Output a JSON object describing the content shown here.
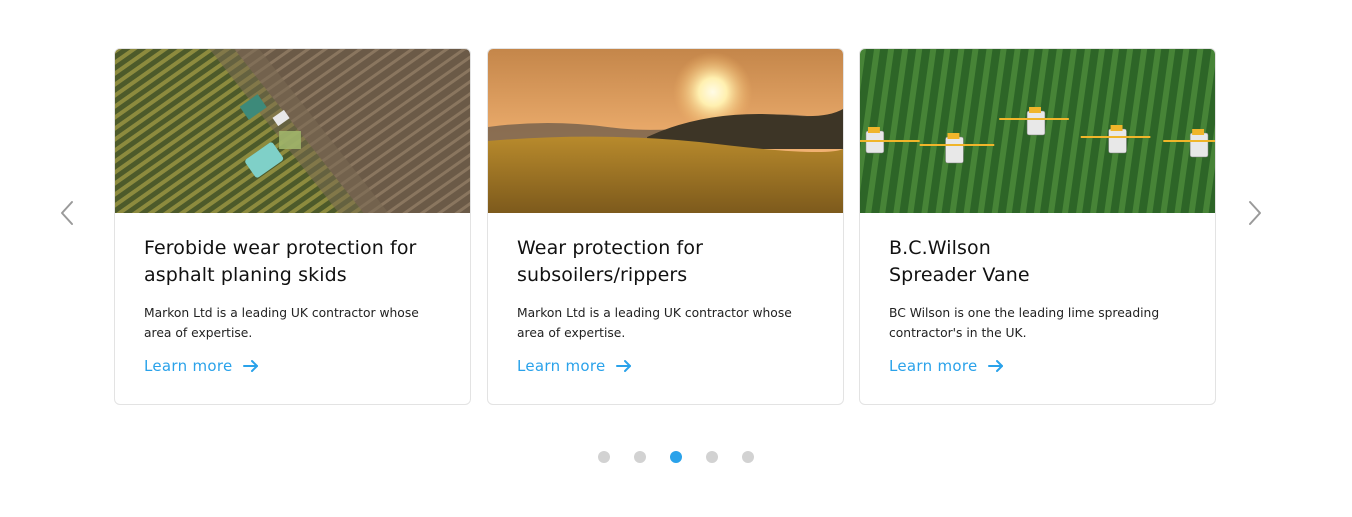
{
  "carousel": {
    "prev_icon": "chevron-left-icon",
    "next_icon": "chevron-right-icon",
    "cards": [
      {
        "title": "Ferobide wear protection for\nasphalt planing skids",
        "description": "Markon Ltd is a leading UK contractor whose area of expertise.",
        "link_label": "Learn more",
        "image": "aerial-harvester-field-image"
      },
      {
        "title": "Wear protection for\nsubsoilers/rippers",
        "description": "Markon Ltd is a leading UK contractor whose area of expertise.",
        "link_label": "Learn more",
        "image": "sunset-wheat-field-image"
      },
      {
        "title": "B.C.Wilson\nSpreader Vane",
        "description": "BC Wilson is one the leading lime spreading contractor's in the UK.",
        "link_label": "Learn more",
        "image": "green-field-sprayers-image"
      }
    ],
    "pagination": {
      "total": 5,
      "active_index": 2
    }
  },
  "colors": {
    "accent": "#2aa2ea",
    "dot_inactive": "#d2d2d2",
    "border": "#e3e3e3"
  }
}
